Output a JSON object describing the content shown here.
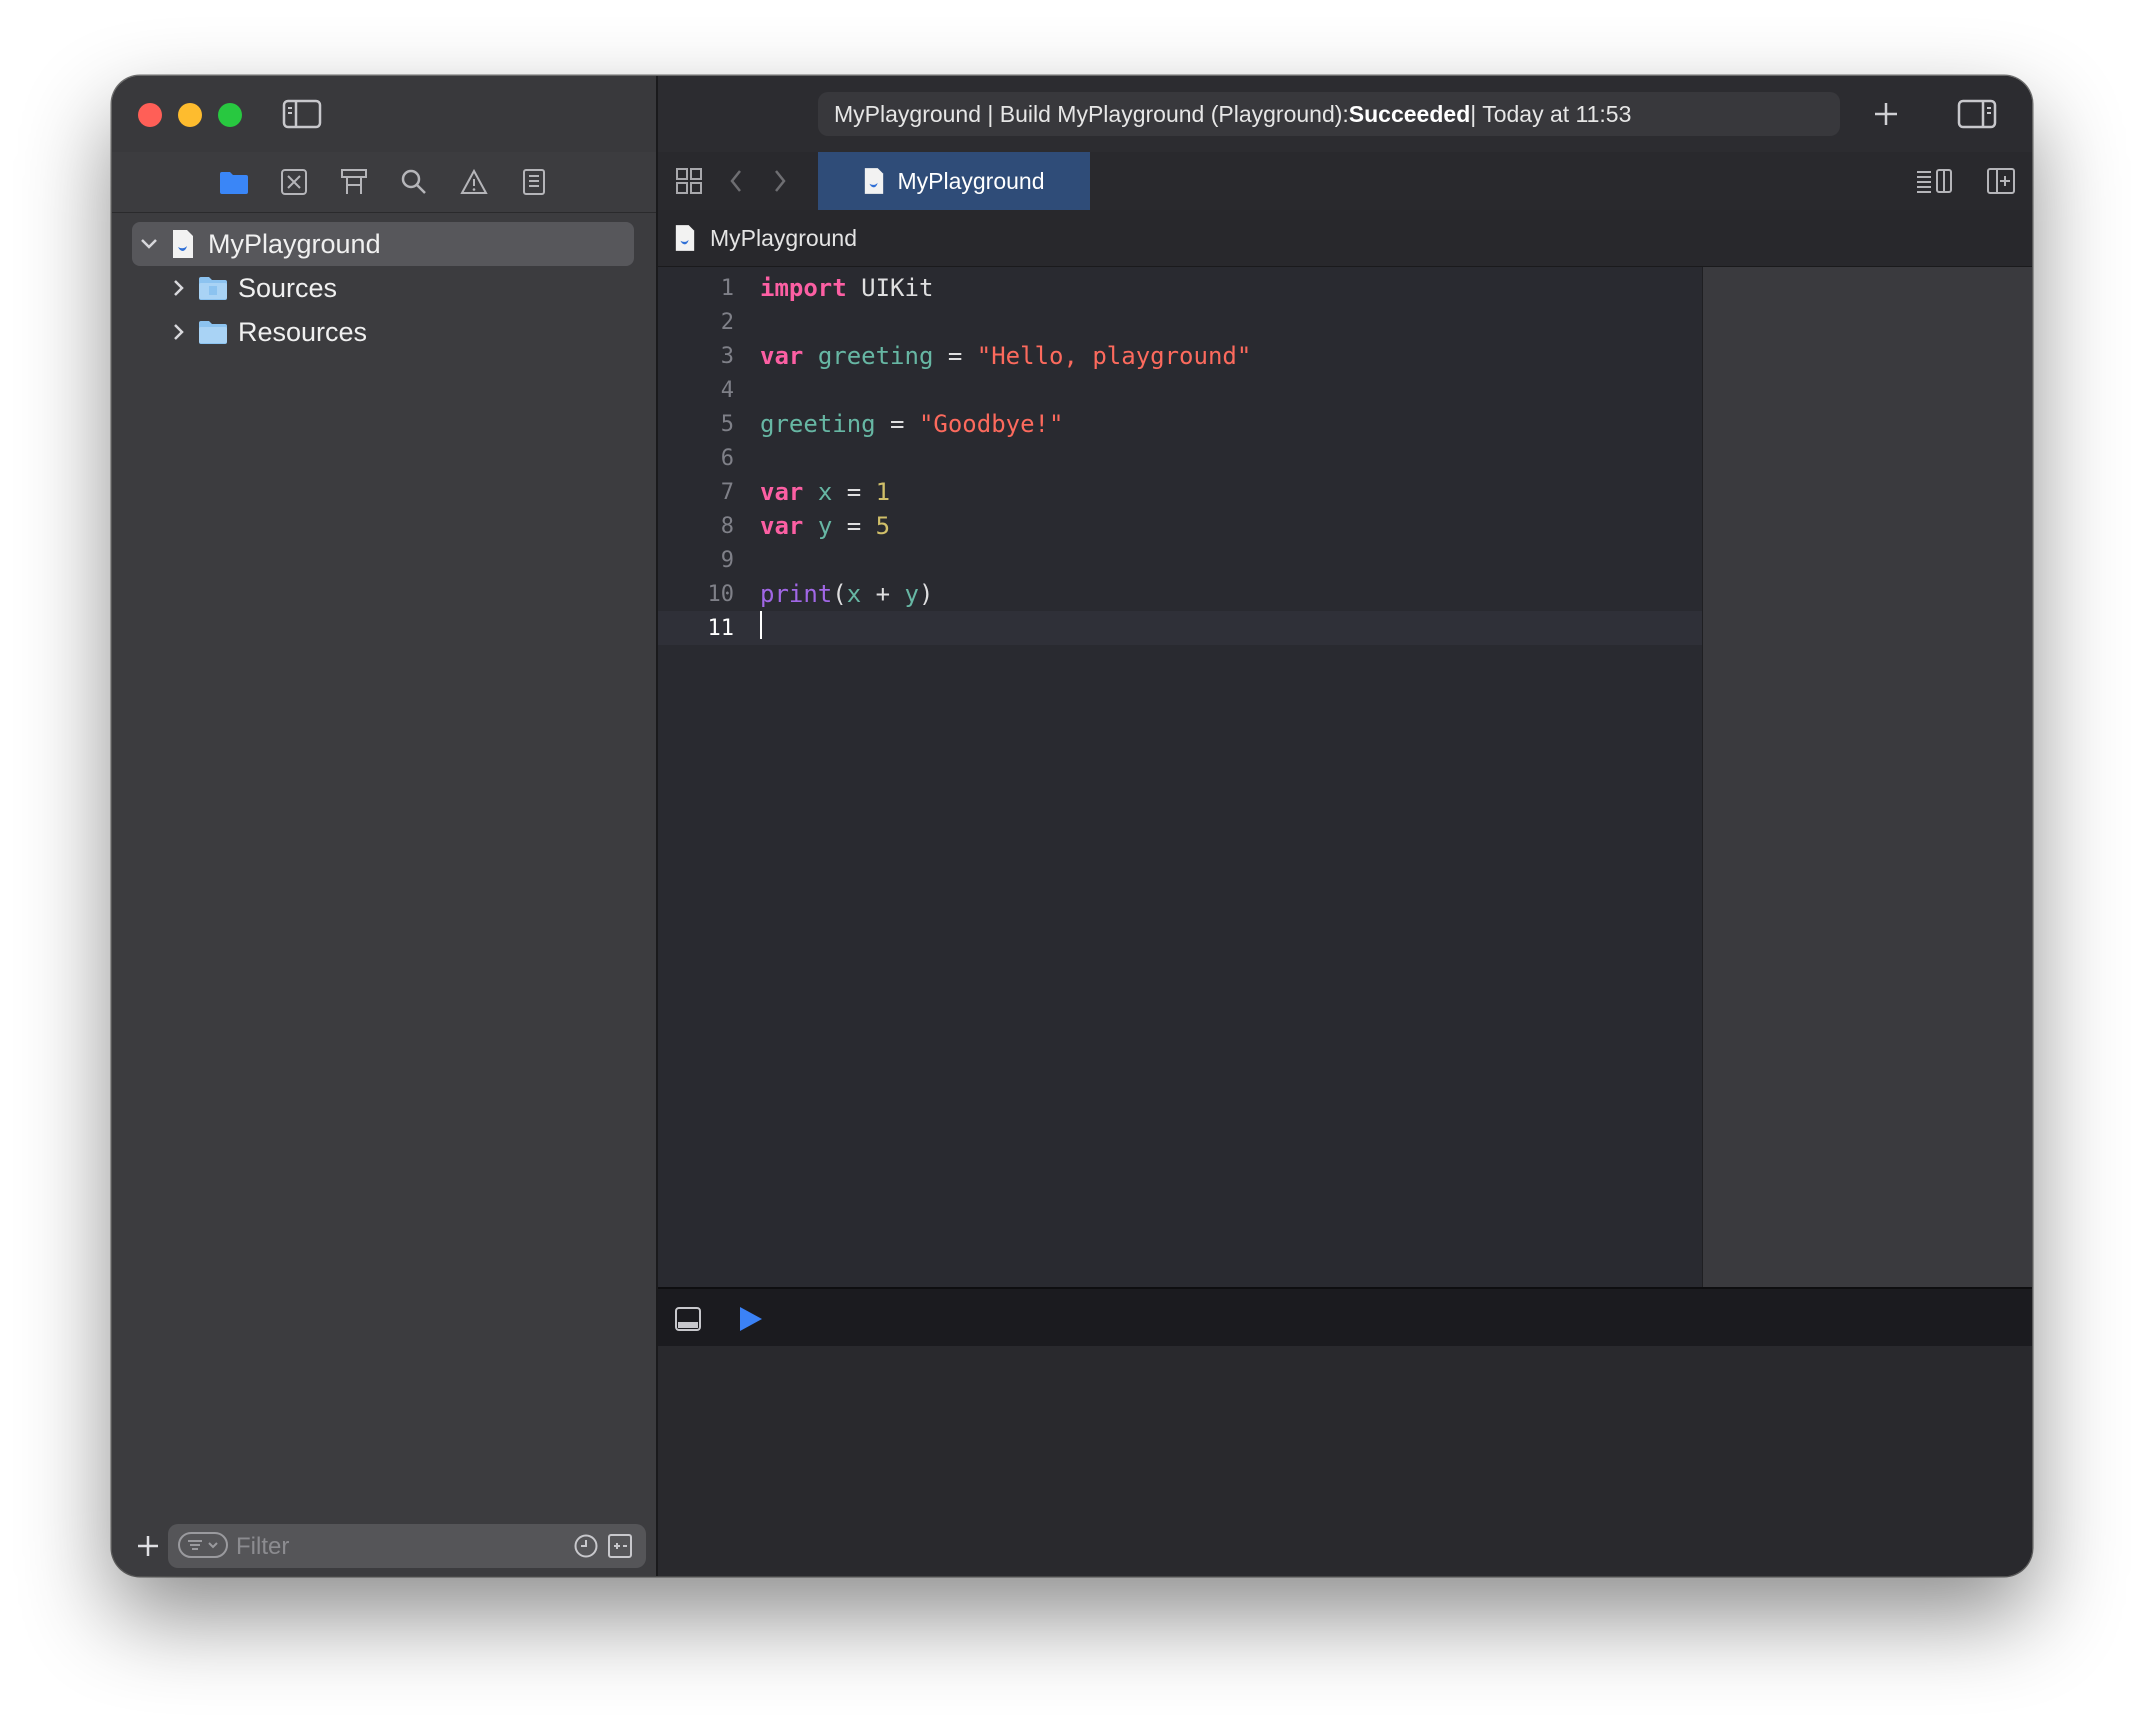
{
  "window": {
    "activity": {
      "prefix": "MyPlayground | Build MyPlayground (Playground): ",
      "status": "Succeeded",
      "suffix": " | Today at 11:53"
    }
  },
  "sidebar": {
    "navigator_tabs": [
      "folder-icon",
      "source-control-icon",
      "symbol-icon",
      "find-icon",
      "issue-icon",
      "report-icon"
    ],
    "tree": [
      {
        "label": "MyPlayground",
        "icon": "swift-file-icon",
        "expanded": true,
        "selected": true
      },
      {
        "label": "Sources",
        "icon": "folder-icon",
        "expanded": false
      },
      {
        "label": "Resources",
        "icon": "folder-icon",
        "expanded": false
      }
    ],
    "filter": {
      "placeholder": "Filter",
      "value": ""
    }
  },
  "editor": {
    "tab_label": "MyPlayground",
    "jump_bar_label": "MyPlayground",
    "lines": [
      {
        "n": "1",
        "tokens": [
          [
            "kw",
            "import"
          ],
          [
            "pl",
            " UIKit"
          ]
        ]
      },
      {
        "n": "2",
        "tokens": []
      },
      {
        "n": "3",
        "tokens": [
          [
            "kw",
            "var"
          ],
          [
            "pl",
            " "
          ],
          [
            "id",
            "greeting"
          ],
          [
            "pl",
            " = "
          ],
          [
            "str",
            "\"Hello, playground\""
          ]
        ]
      },
      {
        "n": "4",
        "tokens": []
      },
      {
        "n": "5",
        "tokens": [
          [
            "id",
            "greeting"
          ],
          [
            "pl",
            " = "
          ],
          [
            "str",
            "\"Goodbye!\""
          ]
        ]
      },
      {
        "n": "6",
        "tokens": []
      },
      {
        "n": "7",
        "tokens": [
          [
            "kw",
            "var"
          ],
          [
            "pl",
            " "
          ],
          [
            "id",
            "x"
          ],
          [
            "pl",
            " = "
          ],
          [
            "num",
            "1"
          ]
        ]
      },
      {
        "n": "8",
        "tokens": [
          [
            "kw",
            "var"
          ],
          [
            "pl",
            " "
          ],
          [
            "id",
            "y"
          ],
          [
            "pl",
            " = "
          ],
          [
            "num",
            "5"
          ]
        ]
      },
      {
        "n": "9",
        "tokens": []
      },
      {
        "n": "10",
        "tokens": [
          [
            "fn",
            "print"
          ],
          [
            "pl",
            "("
          ],
          [
            "id",
            "x"
          ],
          [
            "pl",
            " + "
          ],
          [
            "id",
            "y"
          ],
          [
            "pl",
            ")"
          ]
        ]
      },
      {
        "n": "11",
        "tokens": [],
        "current": true
      }
    ]
  },
  "colors": {
    "keyword": "#fc5fa3",
    "identifier": "#67b7a4",
    "string": "#fc6a5d",
    "number": "#d0bf69",
    "function": "#a167e6",
    "tab_selected": "#2f4c78",
    "run_button": "#3b82f6"
  }
}
